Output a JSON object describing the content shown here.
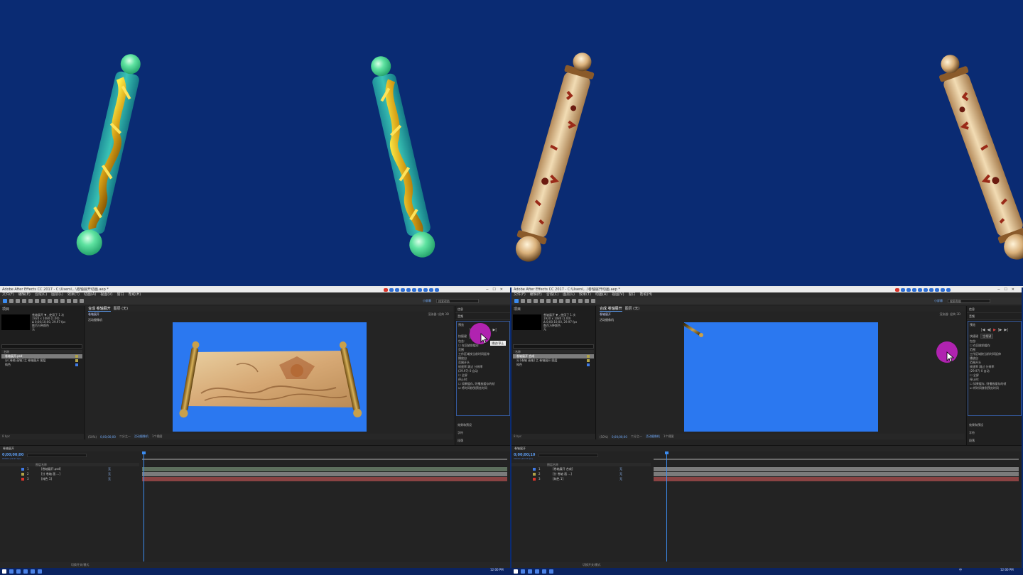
{
  "banner": {
    "scrolls": [
      {
        "name": "jade-dragon-scroll-rod",
        "style": "jade-gold-dragon"
      },
      {
        "name": "jade-dragon-scroll-rod",
        "style": "jade-gold-dragon"
      },
      {
        "name": "ivory-floral-scroll-rod",
        "style": "ivory-red-floral"
      },
      {
        "name": "ivory-floral-scroll-rod",
        "style": "ivory-red-floral"
      }
    ],
    "background_color": "#0a2b73"
  },
  "panes": [
    {
      "title": "Adobe After Effects CC 2017 - C:\\Users\\...\\卷轴展开动画.aep *",
      "menu": [
        "文件(F)",
        "编辑(E)",
        "合成(C)",
        "图层(L)",
        "效果(T)",
        "动画(A)",
        "视图(V)",
        "窗口",
        "帮助(H)"
      ],
      "workspace": "小屏幕",
      "search_placeholder": "搜索帮助",
      "project": {
        "tab": "项目",
        "info": "卷轴展开 ▼ , 使用了 1 次\n1920 x 1080 (1.00)\nΔ 0;00;10;00, 29.97 fps\n数百万种颜色\n无",
        "column": "名称",
        "items": [
          {
            "label": "卷轴展开.psd",
            "selected": true,
            "color": "#b1a347"
          },
          {
            "label": "分 [卷轴 画轴] 之 卷轴展开 图层",
            "selected": false,
            "color": "#b1a347"
          },
          {
            "label": "纯色",
            "selected": false,
            "color": "#3f7ae6"
          }
        ],
        "bpc": "8 bpc"
      },
      "comp": {
        "tabs": [
          "合成 卷轴展开",
          "图层 (无)"
        ],
        "breadcrumb": "卷轴展开",
        "renderer": "渲染器: 经典 3D",
        "label": "活动摄像机",
        "magnification": "(50%)",
        "timecode": "0;00;00;00",
        "quality": "二分之一",
        "camera": "活动摄像机",
        "views": "1个视图"
      },
      "effect_panel": {
        "head1": "信息",
        "head2": "音频",
        "title": "预览",
        "playback": [
          "|◀",
          "◀|",
          "▶",
          "|▶",
          "▶|"
        ],
        "shortcut_label": "快捷键",
        "shortcut_value": "空格键",
        "rows": [
          "包含:",
          "☐ 在回放前缓存",
          "范围",
          "工作区域按当前时间延伸",
          "播放自",
          "范围开头",
          "帧速率  跳过  分辨率",
          "(29.97)  0  自动",
          "☐ 全屏",
          "停止时:",
          "☐ 如果缓存, 则播放缓存的帧",
          "☑ 将时间移到预览时间"
        ],
        "more": [
          "效果和预设",
          "字符",
          "段落"
        ],
        "tooltip": "播放/停止"
      },
      "timeline": {
        "tab": "卷轴展开",
        "timecode": "0;00;00;00",
        "fps": "00000 (29.97 fps)",
        "columns": "图层名称",
        "layers": [
          {
            "num": "1",
            "name": "[卷轴展开.psd]",
            "color": "#3f7ae6",
            "mode": "无"
          },
          {
            "num": "2",
            "name": "[分 卷轴 画 ...]",
            "color": "#b1a347",
            "mode": "无"
          },
          {
            "num": "3",
            "name": "[纯色 1]",
            "color": "#d9342b",
            "mode": "无"
          }
        ],
        "ruler_ticks": [
          "0s",
          "01s",
          "02s",
          "03s",
          "04s",
          "05s",
          "06s",
          "07s",
          "08s",
          "09s",
          "10s"
        ],
        "footer": "切换开关/模式"
      },
      "playhead_position_s": 0.0
    },
    {
      "title": "Adobe After Effects CC 2017 - C:\\Users\\...\\卷轴展开动画.aep *",
      "menu": [
        "文件(F)",
        "编辑(E)",
        "合成(C)",
        "图层(L)",
        "效果(T)",
        "动画(A)",
        "视图(V)",
        "窗口",
        "帮助(H)"
      ],
      "workspace": "小屏幕",
      "search_placeholder": "搜索帮助",
      "project": {
        "tab": "项目",
        "info": "卷轴展开 ▼ , 使用了 1 次\n1920 x 1080 (1.00)\nΔ 0;00;10;00, 29.97 fps\n数百万种颜色\n无",
        "column": "名称",
        "items": [
          {
            "label": "卷轴展开 合成",
            "selected": true,
            "color": "#b1a347"
          },
          {
            "label": "分 [卷轴 画轴] 之 卷轴展开 图层",
            "selected": false,
            "color": "#b1a347"
          },
          {
            "label": "纯色",
            "selected": false,
            "color": "#3f7ae6"
          }
        ],
        "bpc": "8 bpc"
      },
      "comp": {
        "tabs": [
          "合成 卷轴展开",
          "图层 (无)"
        ],
        "breadcrumb": "卷轴展开",
        "renderer": "渲染器: 经典 3D",
        "label": "活动摄像机",
        "magnification": "(50%)",
        "timecode": "0;00;00;00",
        "quality": "二分之一",
        "camera": "活动摄像机",
        "views": "1个视图"
      },
      "effect_panel": {
        "head1": "信息",
        "head2": "音频",
        "title": "预览",
        "playback": [
          "|◀",
          "◀|",
          "▶",
          "|▶",
          "▶|"
        ],
        "shortcut_label": "快捷键",
        "shortcut_value": "空格键",
        "rows": [
          "包含:",
          "☐ 在回放前缓存",
          "范围",
          "工作区域按当前时间延伸",
          "播放自",
          "范围开头",
          "帧速率  跳过  分辨率",
          "(29.97)  0  自动",
          "☐ 全屏",
          "停止时:",
          "☐ 如果缓存, 则播放缓存的帧",
          "☑ 将时间移到预览时间"
        ],
        "more": [
          "效果和预设",
          "字符",
          "段落"
        ],
        "tooltip": ""
      },
      "timeline": {
        "tab": "卷轴展开",
        "timecode": "0;00;00;10",
        "fps": "00010 (29.97 fps)",
        "columns": "图层名称",
        "layers": [
          {
            "num": "1",
            "name": "[卷轴展开 合成]",
            "color": "#3f7ae6",
            "mode": "无"
          },
          {
            "num": "2",
            "name": "[分 卷轴 画 ...]",
            "color": "#b1a347",
            "mode": "无"
          },
          {
            "num": "3",
            "name": "[纯色 1]",
            "color": "#d9342b",
            "mode": "无"
          }
        ],
        "ruler_ticks": [
          "0s",
          "01s",
          "02s",
          "03s",
          "04s",
          "05s",
          "06s",
          "07s",
          "08s",
          "09s",
          "10s"
        ],
        "footer": "切换开关/模式"
      },
      "playhead_position_s": 0.33
    }
  ],
  "taskbar": {
    "left_clock": "12:00 PM",
    "right_clock": "12:00 PM",
    "ime": "中"
  },
  "colors": {
    "viewer_background": "#2b78f0",
    "accent": "#3c8cf0",
    "click_indicator": "#b023b0",
    "label_yellow": "#b1a347",
    "label_red": "#d9342b"
  }
}
